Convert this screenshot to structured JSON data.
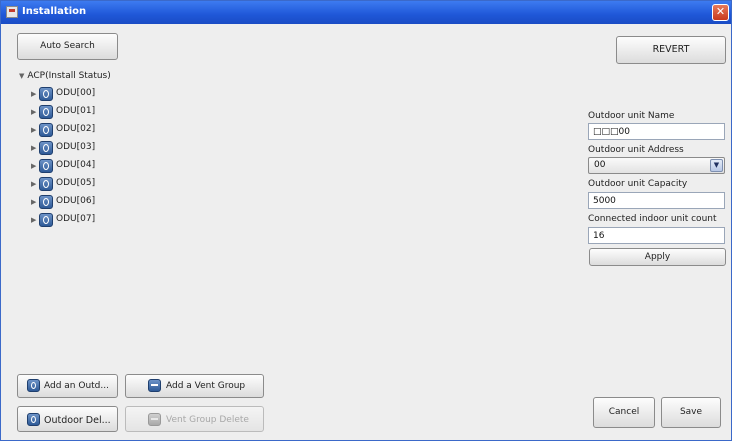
{
  "window": {
    "title": "Installation",
    "close_symbol": "✕"
  },
  "toolbar": {
    "auto_search": "Auto Search",
    "revert": "REVERT"
  },
  "tree": {
    "root_label": "ACP(Install Status)",
    "items": [
      {
        "label": "ODU[00]"
      },
      {
        "label": "ODU[01]"
      },
      {
        "label": "ODU[02]"
      },
      {
        "label": "ODU[03]"
      },
      {
        "label": "ODU[04]"
      },
      {
        "label": "ODU[05]"
      },
      {
        "label": "ODU[06]"
      },
      {
        "label": "ODU[07]"
      }
    ]
  },
  "form": {
    "name_label": "Outdoor unit Name",
    "name_value": "□□□00",
    "address_label": "Outdoor unit Address",
    "address_value": "00",
    "capacity_label": "Outdoor unit Capacity",
    "capacity_value": "5000",
    "indoor_count_label": "Connected indoor unit count",
    "indoor_count_value": "16",
    "apply": "Apply"
  },
  "bottom": {
    "add_outdoor": "Add an Outd...",
    "add_vent_group": "Add a Vent Group",
    "outdoor_delete": "Outdoor Del...",
    "vent_group_delete": "Vent Group Delete",
    "cancel": "Cancel",
    "save": "Save"
  }
}
